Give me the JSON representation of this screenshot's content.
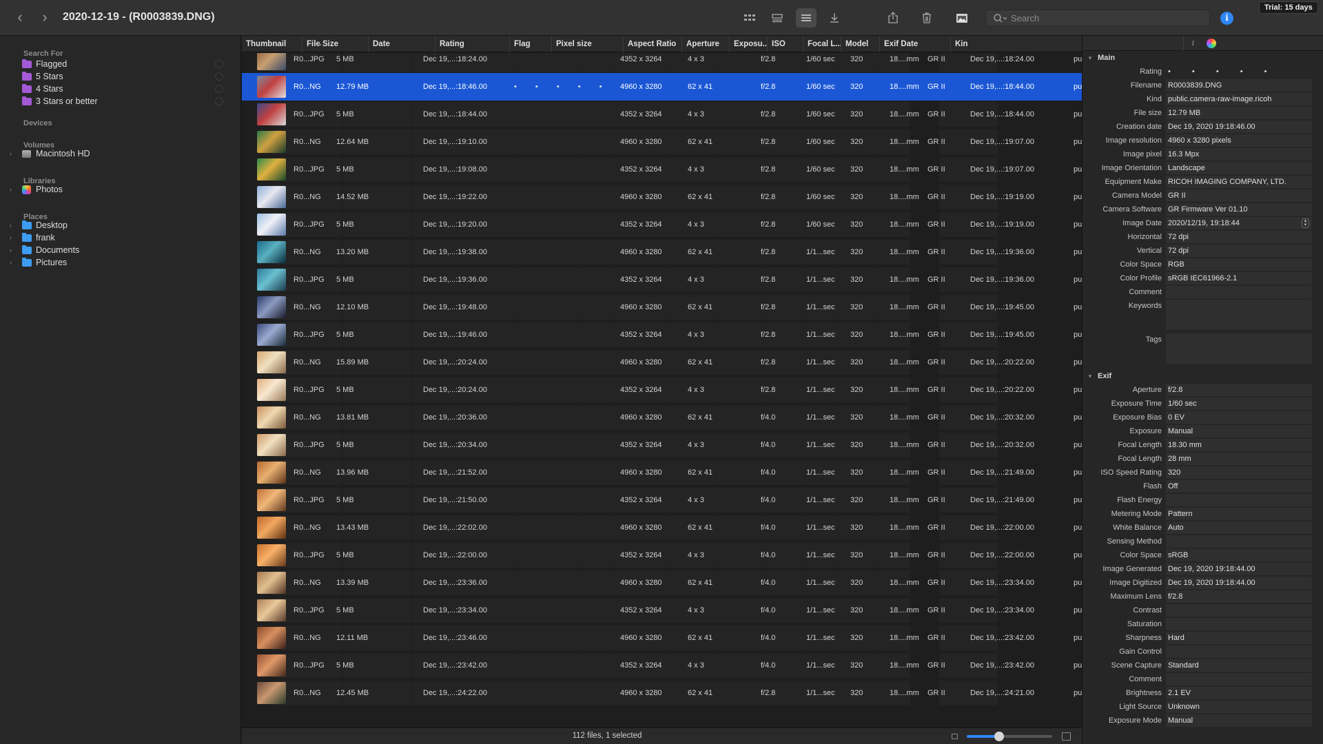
{
  "window": {
    "title": "2020-12-19 - (R0003839.DNG)",
    "trial": "Trial: 15 days",
    "nav_back": "‹",
    "nav_forward": "›"
  },
  "search": {
    "placeholder": "Search",
    "value": ""
  },
  "sidebar": {
    "sections": [
      {
        "header": "Search For",
        "items": [
          {
            "label": "Flagged",
            "icon": "folder-purple-icon",
            "color": "#a45ad6"
          },
          {
            "label": "5 Stars",
            "icon": "folder-purple-icon",
            "color": "#a45ad6"
          },
          {
            "label": "4 Stars",
            "icon": "folder-purple-icon",
            "color": "#a45ad6"
          },
          {
            "label": "3 Stars or better",
            "icon": "folder-purple-icon",
            "color": "#a45ad6"
          }
        ]
      },
      {
        "header": "Devices",
        "items": []
      },
      {
        "header": "Volumes",
        "items": [
          {
            "label": "Macintosh HD",
            "icon": "hard-drive-icon",
            "expandable": true
          }
        ]
      },
      {
        "header": "Libraries",
        "items": [
          {
            "label": "Photos",
            "icon": "photos-app-icon",
            "expandable": true
          }
        ]
      },
      {
        "header": "Places",
        "items": [
          {
            "label": "Desktop",
            "icon": "folder-blue-icon",
            "color": "#3d9df3",
            "expandable": true
          },
          {
            "label": "frank",
            "icon": "folder-blue-icon",
            "color": "#3d9df3",
            "expandable": true
          },
          {
            "label": "Documents",
            "icon": "folder-blue-icon",
            "color": "#3d9df3",
            "expandable": true
          },
          {
            "label": "Pictures",
            "icon": "folder-blue-icon",
            "color": "#3d9df3",
            "expandable": true
          }
        ]
      }
    ]
  },
  "table": {
    "columns": [
      "Thumbnail",
      "File Size",
      "Date",
      "Rating",
      "Flag",
      "Pixel size",
      "Aspect Ratio",
      "Aperture",
      "Exposu...",
      "ISO",
      "Focal L...",
      "Model",
      "Exif Date",
      "Kin"
    ],
    "sorted_column": "Thumbnail",
    "rows": [
      {
        "name": "R0...JPG",
        "size": "5 MB",
        "date": "Dec 19,...:18:24.00",
        "rating": "",
        "pixel": "4352 x 3264",
        "aspect": "4 x 3",
        "aperture": "f/2.8",
        "exposure": "1/60 sec",
        "iso": "320",
        "focal": "18....mm",
        "model": "GR II",
        "exif": "Dec 19,...:18:24.00",
        "kind": "pu",
        "thumb": [
          "#8a5a3a",
          "#c8a070",
          "#3a4a6a"
        ]
      },
      {
        "name": "R0...NG",
        "size": "12.79 MB",
        "date": "Dec 19,...:18:46.00",
        "rating": "• • • • •",
        "pixel": "4960 x 3280",
        "aspect": "62 x 41",
        "aperture": "f/2.8",
        "exposure": "1/60 sec",
        "iso": "320",
        "focal": "18....mm",
        "model": "GR II",
        "exif": "Dec 19,...:18:44.00",
        "kind": "pu",
        "selected": true,
        "thumb": [
          "#7a8aa0",
          "#c04040",
          "#e0e0e0"
        ]
      },
      {
        "name": "R0...JPG",
        "size": "5 MB",
        "date": "Dec 19,...:18:44.00",
        "rating": "",
        "pixel": "4352 x 3264",
        "aspect": "4 x 3",
        "aperture": "f/2.8",
        "exposure": "1/60 sec",
        "iso": "320",
        "focal": "18....mm",
        "model": "GR II",
        "exif": "Dec 19,...:18:44.00",
        "kind": "pu",
        "thumb": [
          "#3a4a8a",
          "#c04040",
          "#d8d8d8"
        ]
      },
      {
        "name": "R0...NG",
        "size": "12.64 MB",
        "date": "Dec 19,...:19:10.00",
        "rating": "",
        "pixel": "4960 x 3280",
        "aspect": "62 x 41",
        "aperture": "f/2.8",
        "exposure": "1/60 sec",
        "iso": "320",
        "focal": "18....mm",
        "model": "GR II",
        "exif": "Dec 19,...:19:07.00",
        "kind": "pu",
        "thumb": [
          "#2a7a4a",
          "#d0a040",
          "#1a3a2a"
        ]
      },
      {
        "name": "R0...JPG",
        "size": "5 MB",
        "date": "Dec 19,...:19:08.00",
        "rating": "",
        "pixel": "4352 x 3264",
        "aspect": "4 x 3",
        "aperture": "f/2.8",
        "exposure": "1/60 sec",
        "iso": "320",
        "focal": "18....mm",
        "model": "GR II",
        "exif": "Dec 19,...:19:07.00",
        "kind": "pu",
        "thumb": [
          "#2a8a4a",
          "#e0b040",
          "#1a4a2a"
        ]
      },
      {
        "name": "R0...NG",
        "size": "14.52 MB",
        "date": "Dec 19,...:19:22.00",
        "rating": "",
        "pixel": "4960 x 3280",
        "aspect": "62 x 41",
        "aperture": "f/2.8",
        "exposure": "1/60 sec",
        "iso": "320",
        "focal": "18....mm",
        "model": "GR II",
        "exif": "Dec 19,...:19:19.00",
        "kind": "pu",
        "thumb": [
          "#8ab0d8",
          "#e8e8f0",
          "#4a6a9a"
        ]
      },
      {
        "name": "R0...JPG",
        "size": "5 MB",
        "date": "Dec 19,...:19:20.00",
        "rating": "",
        "pixel": "4352 x 3264",
        "aspect": "4 x 3",
        "aperture": "f/2.8",
        "exposure": "1/60 sec",
        "iso": "320",
        "focal": "18....mm",
        "model": "GR II",
        "exif": "Dec 19,...:19:19.00",
        "kind": "pu",
        "thumb": [
          "#9ac0e0",
          "#f0f0f8",
          "#5a7aaa"
        ]
      },
      {
        "name": "R0...NG",
        "size": "13.20 MB",
        "date": "Dec 19,...:19:38.00",
        "rating": "",
        "pixel": "4960 x 3280",
        "aspect": "62 x 41",
        "aperture": "f/2.8",
        "exposure": "1/1...sec",
        "iso": "320",
        "focal": "18....mm",
        "model": "GR II",
        "exif": "Dec 19,...:19:36.00",
        "kind": "pu",
        "thumb": [
          "#1a6a8a",
          "#5ab0c0",
          "#0a2a3a"
        ]
      },
      {
        "name": "R0...JPG",
        "size": "5 MB",
        "date": "Dec 19,...:19:36.00",
        "rating": "",
        "pixel": "4352 x 3264",
        "aspect": "4 x 3",
        "aperture": "f/2.8",
        "exposure": "1/1...sec",
        "iso": "320",
        "focal": "18....mm",
        "model": "GR II",
        "exif": "Dec 19,...:19:36.00",
        "kind": "pu",
        "thumb": [
          "#2a7a9a",
          "#6ac0d0",
          "#1a3a4a"
        ]
      },
      {
        "name": "R0...NG",
        "size": "12.10 MB",
        "date": "Dec 19,...:19:48.00",
        "rating": "",
        "pixel": "4960 x 3280",
        "aspect": "62 x 41",
        "aperture": "f/2.8",
        "exposure": "1/1...sec",
        "iso": "320",
        "focal": "18....mm",
        "model": "GR II",
        "exif": "Dec 19,...:19:45.00",
        "kind": "pu",
        "thumb": [
          "#2a3a6a",
          "#8a9ac0",
          "#1a1a2a"
        ]
      },
      {
        "name": "R0...JPG",
        "size": "5 MB",
        "date": "Dec 19,...:19:46.00",
        "rating": "",
        "pixel": "4352 x 3264",
        "aspect": "4 x 3",
        "aperture": "f/2.8",
        "exposure": "1/1...sec",
        "iso": "320",
        "focal": "18....mm",
        "model": "GR II",
        "exif": "Dec 19,...:19:45.00",
        "kind": "pu",
        "thumb": [
          "#3a4a7a",
          "#9aaad0",
          "#1a2a3a"
        ]
      },
      {
        "name": "R0...NG",
        "size": "15.89 MB",
        "date": "Dec 19,...:20:24.00",
        "rating": "",
        "pixel": "4960 x 3280",
        "aspect": "62 x 41",
        "aperture": "f/2.8",
        "exposure": "1/1...sec",
        "iso": "320",
        "focal": "18....mm",
        "model": "GR II",
        "exif": "Dec 19,...:20:22.00",
        "kind": "pu",
        "thumb": [
          "#d8a870",
          "#f0e0c0",
          "#8a6a4a"
        ]
      },
      {
        "name": "R0...JPG",
        "size": "5 MB",
        "date": "Dec 19,...:20:24.00",
        "rating": "",
        "pixel": "4352 x 3264",
        "aspect": "4 x 3",
        "aperture": "f/2.8",
        "exposure": "1/1...sec",
        "iso": "320",
        "focal": "18....mm",
        "model": "GR II",
        "exif": "Dec 19,...:20:22.00",
        "kind": "pu",
        "thumb": [
          "#e0b080",
          "#f8e8d0",
          "#9a7a5a"
        ]
      },
      {
        "name": "R0...NG",
        "size": "13.81 MB",
        "date": "Dec 19,...:20:36.00",
        "rating": "",
        "pixel": "4960 x 3280",
        "aspect": "62 x 41",
        "aperture": "f/4.0",
        "exposure": "1/1...sec",
        "iso": "320",
        "focal": "18....mm",
        "model": "GR II",
        "exif": "Dec 19,...:20:32.00",
        "kind": "pu",
        "thumb": [
          "#c89060",
          "#f0d8b0",
          "#7a5a3a"
        ]
      },
      {
        "name": "R0...JPG",
        "size": "5 MB",
        "date": "Dec 19,...:20:34.00",
        "rating": "",
        "pixel": "4352 x 3264",
        "aspect": "4 x 3",
        "aperture": "f/4.0",
        "exposure": "1/1...sec",
        "iso": "320",
        "focal": "18....mm",
        "model": "GR II",
        "exif": "Dec 19,...:20:32.00",
        "kind": "pu",
        "thumb": [
          "#d09868",
          "#f0e0c0",
          "#8a6a4a"
        ]
      },
      {
        "name": "R0...NG",
        "size": "13.96 MB",
        "date": "Dec 19,...:21:52.00",
        "rating": "",
        "pixel": "4960 x 3280",
        "aspect": "62 x 41",
        "aperture": "f/4.0",
        "exposure": "1/1...sec",
        "iso": "320",
        "focal": "18....mm",
        "model": "GR II",
        "exif": "Dec 19,...:21:49.00",
        "kind": "pu",
        "thumb": [
          "#b86a30",
          "#e8b070",
          "#5a3018"
        ]
      },
      {
        "name": "R0...JPG",
        "size": "5 MB",
        "date": "Dec 19,...:21:50.00",
        "rating": "",
        "pixel": "4352 x 3264",
        "aspect": "4 x 3",
        "aperture": "f/4.0",
        "exposure": "1/1...sec",
        "iso": "320",
        "focal": "18....mm",
        "model": "GR II",
        "exif": "Dec 19,...:21:49.00",
        "kind": "pu",
        "thumb": [
          "#c07038",
          "#f0b878",
          "#603820"
        ]
      },
      {
        "name": "R0...NG",
        "size": "13.43 MB",
        "date": "Dec 19,...:22:02.00",
        "rating": "",
        "pixel": "4960 x 3280",
        "aspect": "62 x 41",
        "aperture": "f/4.0",
        "exposure": "1/1...sec",
        "iso": "320",
        "focal": "18....mm",
        "model": "GR II",
        "exif": "Dec 19,...:22:00.00",
        "kind": "pu",
        "thumb": [
          "#c06828",
          "#f0a860",
          "#603010"
        ]
      },
      {
        "name": "R0...JPG",
        "size": "5 MB",
        "date": "Dec 19,...:22:00.00",
        "rating": "",
        "pixel": "4352 x 3264",
        "aspect": "4 x 3",
        "aperture": "f/4.0",
        "exposure": "1/1...sec",
        "iso": "320",
        "focal": "18....mm",
        "model": "GR II",
        "exif": "Dec 19,...:22:00.00",
        "kind": "pu",
        "thumb": [
          "#c87030",
          "#f8b068",
          "#683818"
        ]
      },
      {
        "name": "R0...NG",
        "size": "13.39 MB",
        "date": "Dec 19,...:23:36.00",
        "rating": "",
        "pixel": "4960 x 3280",
        "aspect": "62 x 41",
        "aperture": "f/4.0",
        "exposure": "1/1...sec",
        "iso": "320",
        "focal": "18....mm",
        "model": "GR II",
        "exif": "Dec 19,...:23:34.00",
        "kind": "pu",
        "thumb": [
          "#a87850",
          "#e0c090",
          "#503020"
        ]
      },
      {
        "name": "R0...JPG",
        "size": "5 MB",
        "date": "Dec 19,...:23:34.00",
        "rating": "",
        "pixel": "4352 x 3264",
        "aspect": "4 x 3",
        "aperture": "f/4.0",
        "exposure": "1/1...sec",
        "iso": "320",
        "focal": "18....mm",
        "model": "GR II",
        "exif": "Dec 19,...:23:34.00",
        "kind": "pu",
        "thumb": [
          "#b08058",
          "#e8c898",
          "#583828"
        ]
      },
      {
        "name": "R0...NG",
        "size": "12.11 MB",
        "date": "Dec 19,...:23:46.00",
        "rating": "",
        "pixel": "4960 x 3280",
        "aspect": "62 x 41",
        "aperture": "f/4.0",
        "exposure": "1/1...sec",
        "iso": "320",
        "focal": "18....mm",
        "model": "GR II",
        "exif": "Dec 19,...:23:42.00",
        "kind": "pu",
        "thumb": [
          "#8a4a2a",
          "#d89060",
          "#3a2018"
        ]
      },
      {
        "name": "R0...JPG",
        "size": "5 MB",
        "date": "Dec 19,...:23:42.00",
        "rating": "",
        "pixel": "4352 x 3264",
        "aspect": "4 x 3",
        "aperture": "f/4.0",
        "exposure": "1/1...sec",
        "iso": "320",
        "focal": "18....mm",
        "model": "GR II",
        "exif": "Dec 19,...:23:42.00",
        "kind": "pu",
        "thumb": [
          "#925232",
          "#e09868",
          "#402818"
        ]
      },
      {
        "name": "R0...NG",
        "size": "12.45 MB",
        "date": "Dec 19,...:24:22.00",
        "rating": "",
        "pixel": "4960 x 3280",
        "aspect": "62 x 41",
        "aperture": "f/2.8",
        "exposure": "1/1...sec",
        "iso": "320",
        "focal": "18....mm",
        "model": "GR II",
        "exif": "Dec 19,...:24:21.00",
        "kind": "pu",
        "thumb": [
          "#6a4a3a",
          "#c89870",
          "#2a3a2a"
        ]
      }
    ]
  },
  "status": {
    "text": "112 files, 1 selected",
    "zoom_fraction": 0.38
  },
  "inspector": {
    "sections": [
      {
        "title": "Main",
        "props": [
          {
            "k": "Rating",
            "v": "• • • • •",
            "type": "rating"
          },
          {
            "k": "Filename",
            "v": "R0003839.DNG"
          },
          {
            "k": "Kind",
            "v": "public.camera-raw-image.ricoh"
          },
          {
            "k": "File size",
            "v": "12.79 MB"
          },
          {
            "k": "Creation date",
            "v": "Dec 19, 2020 19:18:46.00"
          },
          {
            "k": "Image resolution",
            "v": "4960 x 3280 pixels"
          },
          {
            "k": "Image pixel",
            "v": "16.3 Mpx"
          },
          {
            "k": "Image Orientation",
            "v": "Landscape"
          },
          {
            "k": "Equipment Make",
            "v": "RICOH IMAGING COMPANY, LTD."
          },
          {
            "k": "Camera Model",
            "v": "GR II"
          },
          {
            "k": "Camera Software",
            "v": "GR Firmware Ver 01.10"
          },
          {
            "k": "Image Date",
            "v": "2020/12/19,  19:18:44",
            "type": "stepper"
          },
          {
            "k": "Horizontal",
            "v": "72 dpi"
          },
          {
            "k": "Vertical",
            "v": "72 dpi"
          },
          {
            "k": "Color Space",
            "v": "RGB"
          },
          {
            "k": "Color Profile",
            "v": "sRGB IEC61966-2.1"
          },
          {
            "k": "Comment",
            "v": ""
          },
          {
            "k": "Keywords",
            "v": "",
            "type": "bigbox"
          },
          {
            "k": "Tags",
            "v": "",
            "type": "bigbox"
          }
        ]
      },
      {
        "title": "Exif",
        "props": [
          {
            "k": "Aperture",
            "v": "f/2.8"
          },
          {
            "k": "Exposure Time",
            "v": "1/60 sec"
          },
          {
            "k": "Exposure Bias",
            "v": "0 EV"
          },
          {
            "k": "Exposure",
            "v": "Manual"
          },
          {
            "k": "Focal Length",
            "v": "18.30 mm"
          },
          {
            "k": "Focal Length",
            "v": "28 mm"
          },
          {
            "k": "ISO Speed Rating",
            "v": "320"
          },
          {
            "k": "Flash",
            "v": "Off"
          },
          {
            "k": "Flash Energy",
            "v": ""
          },
          {
            "k": "Metering Mode",
            "v": "Pattern"
          },
          {
            "k": "White Balance",
            "v": "Auto"
          },
          {
            "k": "Sensing Method",
            "v": ""
          },
          {
            "k": "Color Space",
            "v": "sRGB"
          },
          {
            "k": "Image Generated",
            "v": "Dec 19, 2020 19:18:44.00"
          },
          {
            "k": "Image Digitized",
            "v": "Dec 19, 2020 19:18:44.00"
          },
          {
            "k": "Maximum Lens",
            "v": "f/2.8"
          },
          {
            "k": "Contrast",
            "v": ""
          },
          {
            "k": "Saturation",
            "v": ""
          },
          {
            "k": "Sharpness",
            "v": "Hard"
          },
          {
            "k": "Gain Control",
            "v": ""
          },
          {
            "k": "Scene Capture",
            "v": "Standard"
          },
          {
            "k": "Comment",
            "v": ""
          },
          {
            "k": "Brightness",
            "v": "2.1 EV"
          },
          {
            "k": "Light Source",
            "v": "Unknown"
          },
          {
            "k": "Exposure Mode",
            "v": "Manual"
          }
        ]
      }
    ]
  },
  "colors": {
    "selection": "#1b57d5",
    "accent": "#2f86f5"
  }
}
